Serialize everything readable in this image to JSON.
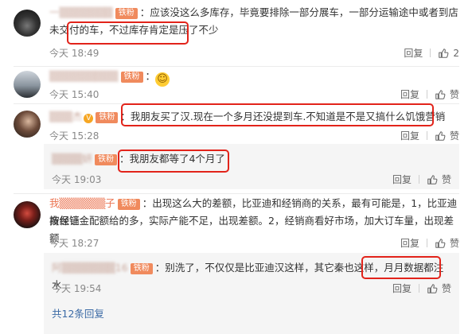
{
  "comments": [
    {
      "user": "一▒▒▒▒▒▒▒",
      "fan_label": "铁粉",
      "text": "应该没这么多库存，毕竟要排除一部分展车，一部分运输途中或者到店未交付的车，",
      "highlight": "不过库存肯定是压了不少",
      "time": "今天 18:49",
      "reply": "回复",
      "likes": "2"
    },
    {
      "user": "▒▒▒▒▒▒▒▒▒",
      "fan_label": "铁粉",
      "emoji": "😂",
      "time": "今天 15:40",
      "reply": "回复",
      "like": "赞"
    },
    {
      "user": "▒▒▒杰",
      "fan_label": "铁粉",
      "text": "我朋友买了汉.现在一个多月还没提到车.不知道是不是又搞什么饥饿营销",
      "time": "今天 15:28",
      "reply": "回复",
      "like": "赞",
      "sub_reply": {
        "user": "▒▒▒▒妍",
        "fan_label": "铁粉",
        "text": "我朋友都等了4个月了",
        "time": "今天 19:03",
        "reply": "回复",
        "like": "赞"
      }
    },
    {
      "user": "我▒▒▒▒▒▒子",
      "fan_label": "铁粉",
      "text1": "出现这么大的差额，比亚迪和经销商的关系，最有可能是，1，比亚迪按经销",
      "text2": "商保证金配额给的多，实际产能不足，出现差额。2，经销商看好市场，加大订车量，出现差额",
      "time": "今天 18:27",
      "reply": "回复",
      "like": "赞",
      "sub_reply": {
        "user": "阿▒▒▒▒▒▒▒16",
        "fan_label": "铁粉",
        "text": "别洗了，不仅仅是比亚迪汉这样，其它秦也这样，",
        "highlight": "月月数据都注水",
        "time": "今天 19:54",
        "reply": "回复",
        "like": "赞"
      },
      "more_replies": "共12条回复"
    }
  ],
  "colors": {
    "highlight_border": "#e2231a",
    "username": "#eb7350",
    "link": "#3b6aa5"
  }
}
